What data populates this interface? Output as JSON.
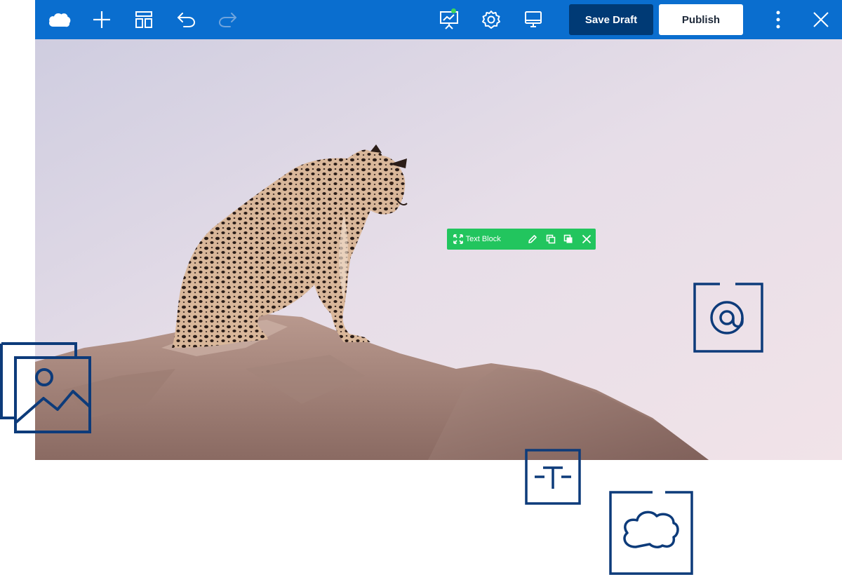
{
  "toolbar": {
    "save_label": "Save Draft",
    "publish_label": "Publish",
    "colors": {
      "bar": "#0a6ecf",
      "save_bg": "#003a75",
      "publish_bg": "#ffffff",
      "status": "#3dd65a"
    },
    "icons": [
      "cloud-logo-icon",
      "add-icon",
      "layout-icon",
      "undo-icon",
      "redo-icon",
      "analytics-icon",
      "gear-icon",
      "desktop-preview-icon",
      "more-vertical-icon",
      "close-icon"
    ]
  },
  "element_toolbar": {
    "label": "Text Block",
    "color": "#22c55e",
    "icons": [
      "move-icon",
      "edit-icon",
      "duplicate-icon",
      "copy-style-icon",
      "remove-icon"
    ]
  },
  "canvas": {
    "image": "leopard-on-rock"
  },
  "widgets": {
    "color": "#0d3b7a",
    "icons": [
      "image-widget-icon",
      "at-sign-widget-icon",
      "text-widget-icon",
      "cloud-widget-icon"
    ]
  }
}
